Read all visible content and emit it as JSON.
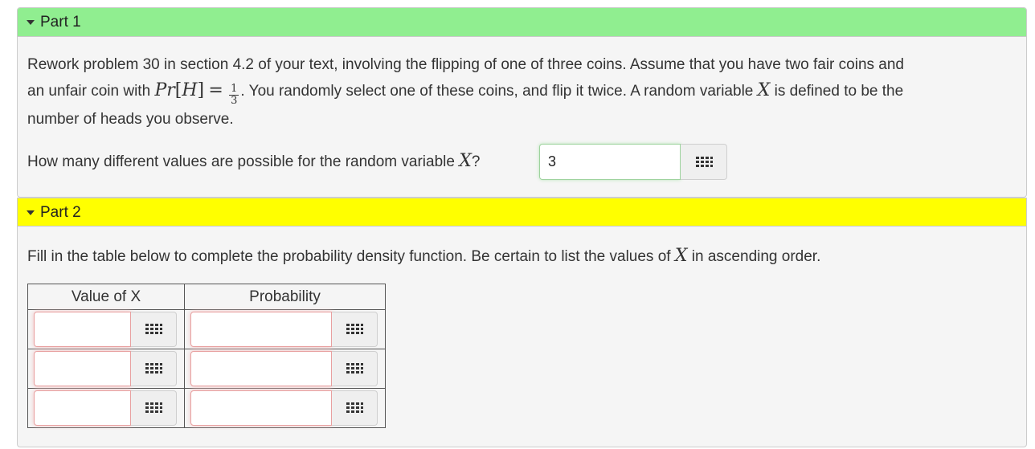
{
  "part1": {
    "header": "Part 1",
    "problem": {
      "t1": "Rework problem 30 in section 4.2 of your text, involving the flipping of one of three coins. Assume that you have two fair coins and",
      "t2": "an unfair coin with",
      "math_pr": "Pr",
      "math_lb": "[",
      "math_H": "H",
      "math_rb": "]",
      "math_eq": "=",
      "frac_num": "1",
      "frac_den": "3",
      "t3": ". You randomly select one of these coins, and flip it twice. A random variable",
      "math_X": "X",
      "t4": "is defined to be the",
      "t5": "number of heads you observe."
    },
    "question": {
      "text": "How many different values are possible for the random variable",
      "math_X": "X",
      "qmark": "?"
    },
    "answer_value": "3"
  },
  "part2": {
    "header": "Part 2",
    "instruction": {
      "t1": "Fill in the table below to complete the probability density function. Be certain to list the values of",
      "math_X": "X",
      "t2": "in ascending order."
    },
    "table": {
      "headers": [
        "Value of X",
        "Probability"
      ],
      "rows": [
        {
          "value": "",
          "probability": ""
        },
        {
          "value": "",
          "probability": ""
        },
        {
          "value": "",
          "probability": ""
        }
      ]
    }
  },
  "icons": {
    "collapse": "caret-down-icon",
    "palette": "grid-icon"
  }
}
